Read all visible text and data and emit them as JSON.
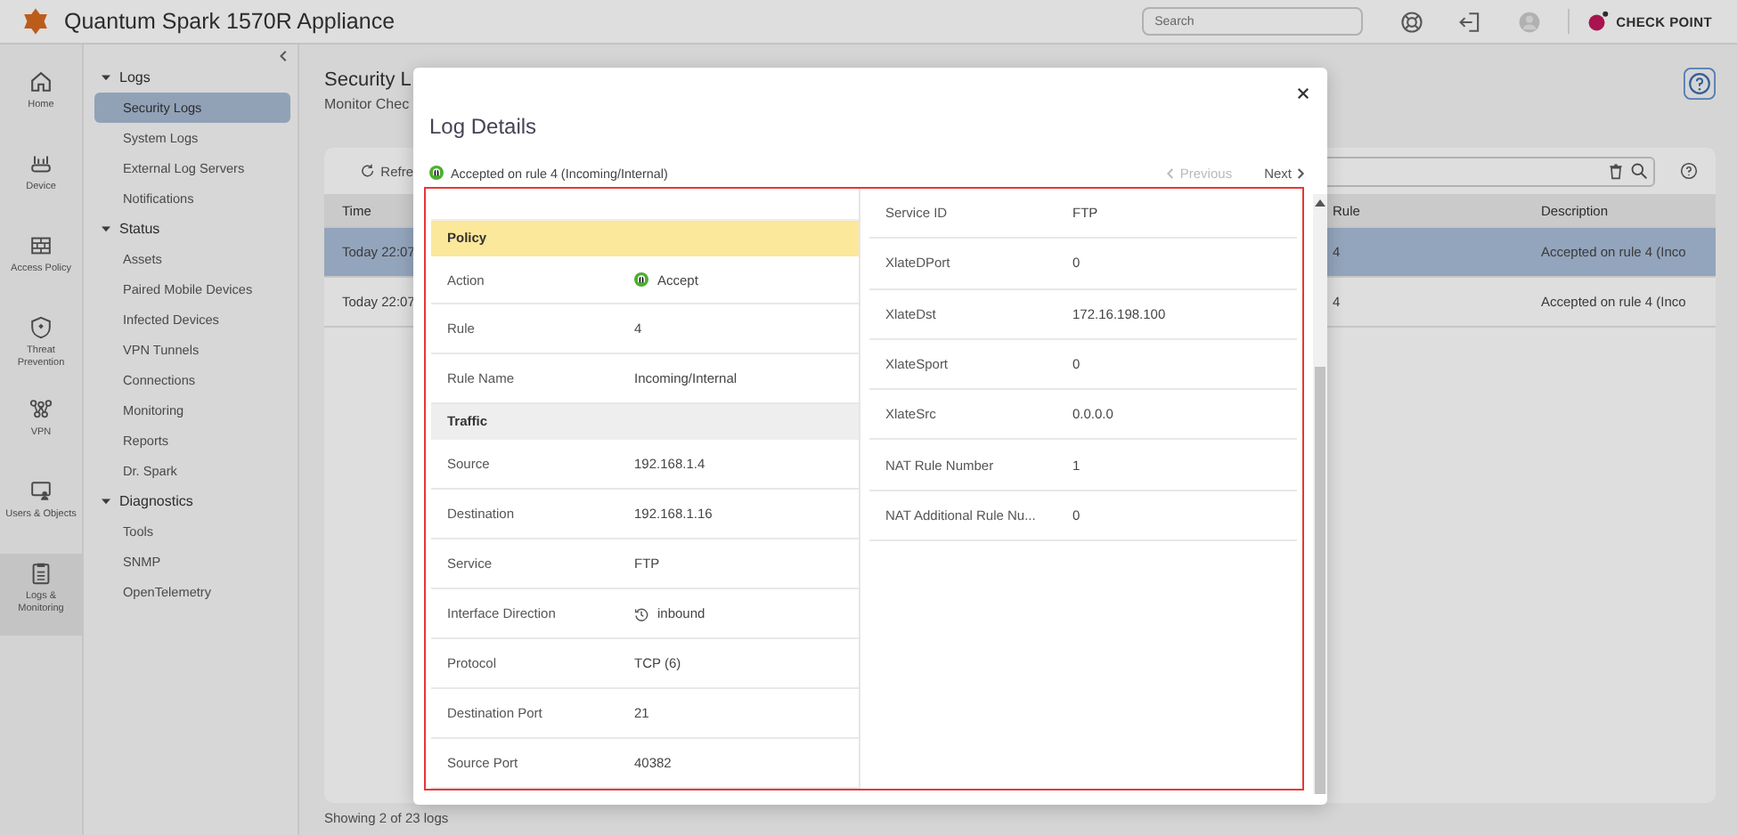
{
  "app": {
    "title": "Quantum Spark 1570R Appliance",
    "search": {
      "placeholder": "Search"
    },
    "brand": "CHECK POINT"
  },
  "rail": [
    {
      "kind": "home",
      "label": "Home",
      "selected": false
    },
    {
      "kind": "device",
      "label": "Device",
      "selected": false
    },
    {
      "kind": "policy",
      "label": "Access Policy",
      "selected": false
    },
    {
      "kind": "threat",
      "label": "Threat Prevention",
      "selected": false
    },
    {
      "kind": "vpn",
      "label": "VPN",
      "selected": false
    },
    {
      "kind": "users",
      "label": "Users & Objects",
      "selected": false
    },
    {
      "kind": "logs",
      "label": "Logs & Monitoring",
      "selected": true
    }
  ],
  "nav": [
    {
      "label": "Logs",
      "expanded": true,
      "children": [
        {
          "label": "Security Logs",
          "selected": true
        },
        {
          "label": "System Logs",
          "selected": false
        },
        {
          "label": "External Log Servers",
          "selected": false
        },
        {
          "label": "Notifications",
          "selected": false
        }
      ]
    },
    {
      "label": "Status",
      "expanded": true,
      "children": [
        {
          "label": "Assets",
          "selected": false
        },
        {
          "label": "Paired Mobile Devices",
          "selected": false
        },
        {
          "label": "Infected Devices",
          "selected": false
        },
        {
          "label": "VPN Tunnels",
          "selected": false
        },
        {
          "label": "Connections",
          "selected": false
        },
        {
          "label": "Monitoring",
          "selected": false
        },
        {
          "label": "Reports",
          "selected": false
        },
        {
          "label": "Dr. Spark",
          "selected": false
        }
      ]
    },
    {
      "label": "Diagnostics",
      "expanded": true,
      "children": [
        {
          "label": "Tools",
          "selected": false
        },
        {
          "label": "SNMP",
          "selected": false
        },
        {
          "label": "OpenTelemetry",
          "selected": false
        }
      ]
    }
  ],
  "page": {
    "title": "Security L",
    "subtitle": "Monitor Chec",
    "refresh": "Refre",
    "columns": [
      "Time",
      "Rule",
      "Description"
    ],
    "rows": [
      {
        "time": "Today 22:07",
        "rule": "4",
        "description": "Accepted on rule 4 (Inco",
        "selected": true
      },
      {
        "time": "Today 22:07",
        "rule": "4",
        "description": "Accepted on rule 4 (Inco",
        "selected": false
      }
    ],
    "footer": "Showing 2 of 23 logs"
  },
  "dialog": {
    "title": "Log Details",
    "summary": "Accepted on rule 4 (Incoming/Internal)",
    "previous": {
      "label": "Previous",
      "disabled": true
    },
    "next": {
      "label": "Next",
      "disabled": false
    },
    "left": [
      {
        "kind": "header",
        "label": "Policy",
        "color": "#fbe89a"
      },
      {
        "kind": "accept",
        "label": "Action",
        "value": "Accept"
      },
      {
        "kind": "field",
        "label": "Rule",
        "value": "4"
      },
      {
        "kind": "field",
        "label": "Rule Name",
        "value": "Incoming/Internal"
      },
      {
        "kind": "header",
        "label": "Traffic",
        "color": "#eeeeee"
      },
      {
        "kind": "field",
        "label": "Source",
        "value": "192.168.1.4"
      },
      {
        "kind": "field",
        "label": "Destination",
        "value": "192.168.1.16"
      },
      {
        "kind": "field",
        "label": "Service",
        "value": "FTP"
      },
      {
        "kind": "direction",
        "label": "Interface Direction",
        "value": "inbound"
      },
      {
        "kind": "field",
        "label": "Protocol",
        "value": "TCP (6)"
      },
      {
        "kind": "field",
        "label": "Destination Port",
        "value": "21"
      },
      {
        "kind": "field",
        "label": "Source Port",
        "value": "40382"
      }
    ],
    "right": [
      {
        "label": "Service ID",
        "value": "FTP"
      },
      {
        "label": "XlateDPort",
        "value": "0"
      },
      {
        "label": "XlateDst",
        "value": "172.16.198.100"
      },
      {
        "label": "XlateSport",
        "value": "0"
      },
      {
        "label": "XlateSrc",
        "value": "0.0.0.0"
      },
      {
        "label": "NAT Rule Number",
        "value": "1"
      },
      {
        "label": "NAT Additional Rule Nu...",
        "value": "0"
      }
    ]
  }
}
